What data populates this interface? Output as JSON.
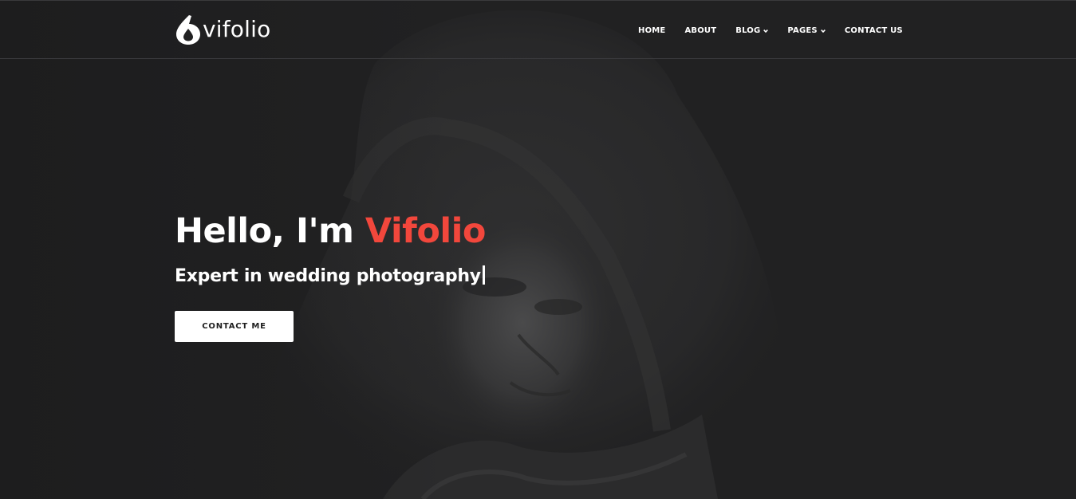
{
  "brand": {
    "logo_text": "vifolio",
    "logo_icon": "drop-six-logo-icon"
  },
  "nav": {
    "items": [
      {
        "label": "HOME",
        "has_dropdown": false
      },
      {
        "label": "ABOUT",
        "has_dropdown": false
      },
      {
        "label": "BLOG",
        "has_dropdown": true
      },
      {
        "label": "PAGES",
        "has_dropdown": true
      },
      {
        "label": "CONTACT US",
        "has_dropdown": false
      }
    ]
  },
  "hero": {
    "title_prefix": "Hello, I'm ",
    "title_name": "Vifolio",
    "subtitle": "Expert in wedding photography",
    "button_label": "CONTACT ME"
  },
  "colors": {
    "background": "#212122",
    "accent": "#f2473c",
    "text": "#ffffff",
    "button_bg": "#ffffff",
    "button_text": "#1e1e1e"
  }
}
